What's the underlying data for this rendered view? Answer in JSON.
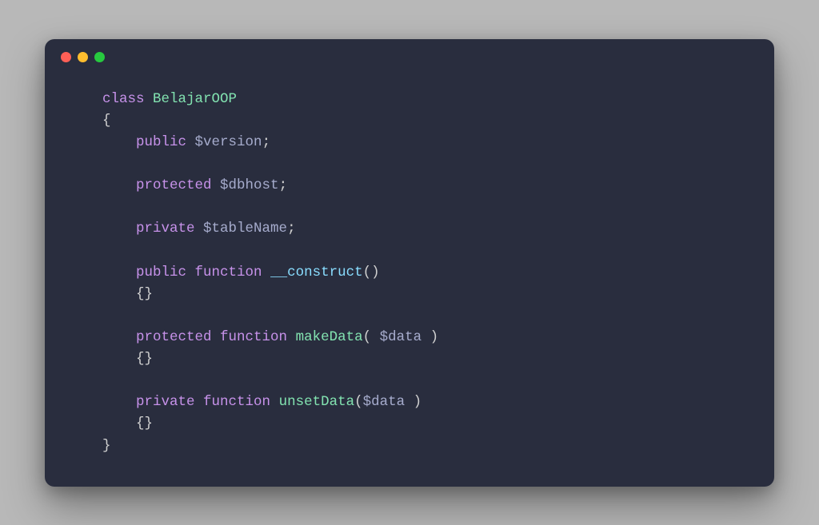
{
  "window": {
    "traffic_lights": [
      "red",
      "yellow",
      "green"
    ]
  },
  "code": {
    "class_keyword": "class",
    "class_name": "BelajarOOP",
    "open_brace": "{",
    "close_brace": "}",
    "indent1": "    ",
    "members": {
      "m1_mod": "public",
      "m1_var": "$version",
      "m2_mod": "protected",
      "m2_var": "$dbhost",
      "m3_mod": "private",
      "m3_var": "$tableName"
    },
    "fn_kw": "function",
    "fns": {
      "f1_mod": "public",
      "f1_name": "__construct",
      "f1_params_open": "(",
      "f1_params_close": ")",
      "f2_mod": "protected",
      "f2_name": "makeData",
      "f2_params_open": "(",
      "f2_param": " $data ",
      "f2_params_close": ")",
      "f3_mod": "private",
      "f3_name": "unsetData",
      "f3_params_open": "(",
      "f3_param": "$data ",
      "f3_params_close": ")"
    },
    "semicolon": ";",
    "empty_body": "{}"
  }
}
